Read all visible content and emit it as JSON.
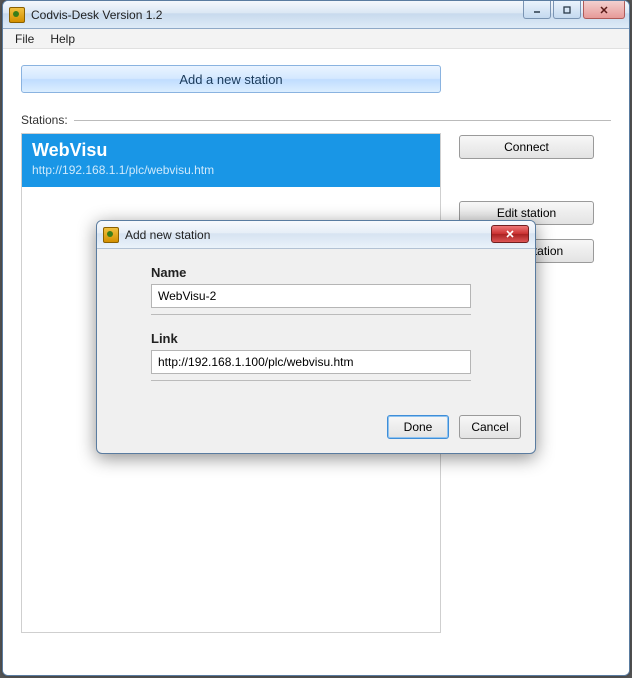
{
  "window": {
    "title": "Codvis-Desk Version 1.2"
  },
  "menubar": {
    "file": "File",
    "help": "Help"
  },
  "main": {
    "add_station_label": "Add a new station",
    "stations_label": "Stations:",
    "station": {
      "name": "WebVisu",
      "url": "http://192.168.1.1/plc/webvisu.htm"
    }
  },
  "sidebar": {
    "connect": "Connect",
    "edit": "Edit station",
    "delete": "Delete station"
  },
  "dialog": {
    "title": "Add new station",
    "name_label": "Name",
    "name_value": "WebVisu-2",
    "link_label": "Link",
    "link_value": "http://192.168.1.100/plc/webvisu.htm",
    "done": "Done",
    "cancel": "Cancel"
  }
}
